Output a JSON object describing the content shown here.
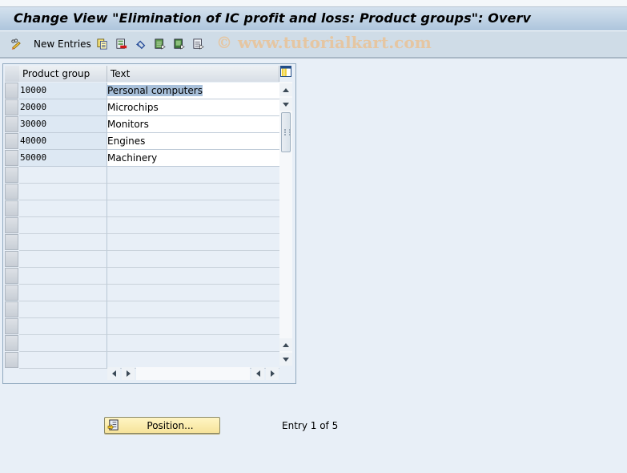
{
  "window": {
    "title": "Change View \"Elimination of IC profit and loss: Product groups\": Overv"
  },
  "toolbar": {
    "new_entries_label": "New Entries",
    "icons": [
      "edit-glasses-icon",
      "copy-icon",
      "delete-icon",
      "undo-icon",
      "select-all-icon",
      "select-block-icon",
      "deselect-all-icon"
    ],
    "watermark": "© www.tutorialkart.com"
  },
  "table": {
    "columns": [
      "Product group",
      "Text"
    ],
    "rows": [
      {
        "code": "10000",
        "text": "Personal computers",
        "selected_text": true
      },
      {
        "code": "20000",
        "text": "Microchips"
      },
      {
        "code": "30000",
        "text": "Monitors"
      },
      {
        "code": "40000",
        "text": "Engines"
      },
      {
        "code": "50000",
        "text": "Machinery"
      }
    ],
    "empty_rows": 12
  },
  "footer": {
    "position_button_label": "Position...",
    "entry_status": "Entry 1 of 5"
  },
  "colors": {
    "title_gradient_top": "#d4e1ee",
    "title_gradient_bottom": "#adc5dc",
    "toolbar_bg": "#cfdce7",
    "page_bg": "#e8eff7",
    "position_button": "#f6e39a",
    "watermark": "#e8c49b"
  }
}
